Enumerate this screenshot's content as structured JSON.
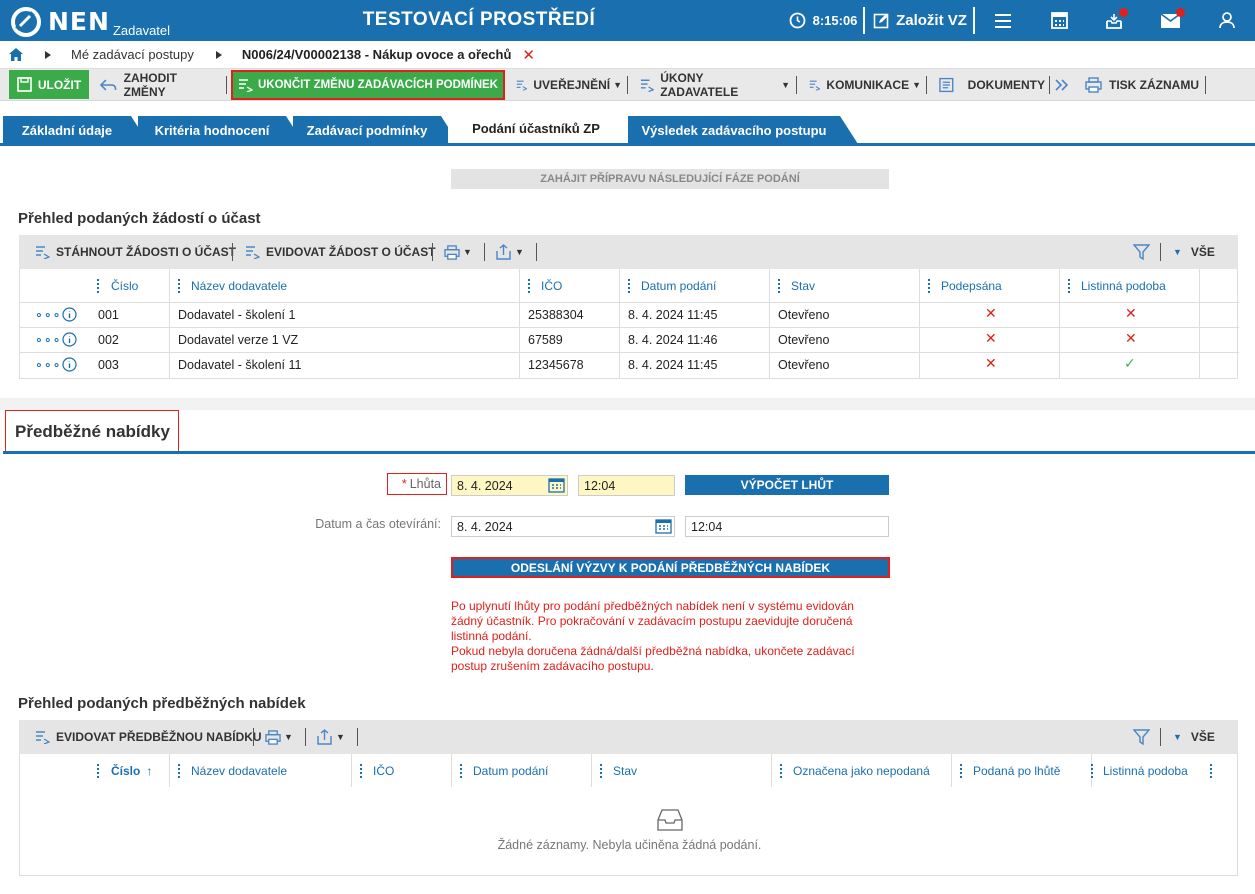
{
  "app": {
    "name": "NEN",
    "subtitle": "Zadavatel",
    "environment": "TESTOVACÍ PROSTŘEDÍ"
  },
  "topbar": {
    "time": "8:15:06",
    "create_label": "Založit VZ",
    "icons": [
      "clock-icon",
      "edit-icon",
      "menu-icon",
      "calculator-icon",
      "inbox-icon",
      "mail-icon",
      "user-icon"
    ],
    "accent": "#1a6fae",
    "badge_color": "#e0201b"
  },
  "breadcrumb": {
    "items": [
      "Mé zadávací postupy",
      "N006/24/V00002138 - Nákup ovoce a ořechů"
    ]
  },
  "toolbar": {
    "save": "ULOŽIT",
    "discard": "ZAHODIT ZMĚNY",
    "finish": "UKONČIT ZMĚNU ZADÁVACÍCH PODMÍNEK",
    "publish": "UVEŘEJNĚNÍ",
    "actions": "ÚKONY ZADAVATELE",
    "communication": "KOMUNIKACE",
    "documents": "DOKUMENTY",
    "print": "TISK ZÁZNAMU"
  },
  "tabs": [
    {
      "label": "Základní údaje"
    },
    {
      "label": "Kritéria hodnocení"
    },
    {
      "label": "Zadávací podmínky"
    },
    {
      "label": "Podání účastníků ZP",
      "active": true
    },
    {
      "label": "Výsledek zadávacího postupu"
    }
  ],
  "phase_button": "ZAHÁJIT PŘÍPRAVU NÁSLEDUJÍCÍ FÁZE PODÁNÍ",
  "requests": {
    "title": "Přehled podaných žádostí o účast",
    "toolbar": {
      "download": "STÁHNOUT ŽÁDOSTI O ÚČAST",
      "register": "EVIDOVAT ŽÁDOST O ÚČAST",
      "all": "VŠE"
    },
    "columns": [
      "Číslo",
      "Název dodavatele",
      "IČO",
      "Datum podání",
      "Stav",
      "Podepsána",
      "Listinná podoba"
    ],
    "rows": [
      {
        "cislo": "001",
        "nazev": "Dodavatel - školení 1",
        "ico": "25388304",
        "datum": "8. 4. 2024 11:45",
        "stav": "Otevřeno",
        "podepsana": "✕",
        "listinna": "✕"
      },
      {
        "cislo": "002",
        "nazev": "Dodavatel verze 1 VZ",
        "ico": "67589",
        "datum": "8. 4. 2024 11:46",
        "stav": "Otevřeno",
        "podepsana": "✕",
        "listinna": "✕"
      },
      {
        "cislo": "003",
        "nazev": "Dodavatel - školení 11",
        "ico": "12345678",
        "datum": "8. 4. 2024 11:45",
        "stav": "Otevřeno",
        "podepsana": "✕",
        "listinna": "✓"
      }
    ]
  },
  "preliminary": {
    "title": "Předběžné nabídky",
    "deadline_label": "Lhůta",
    "required_mark": "*",
    "deadline_date": "8. 4. 2024",
    "deadline_time": "12:04",
    "calc_button": "VÝPOČET LHŮT",
    "open_label": "Datum a čas otevírání:",
    "open_date": "8. 4. 2024",
    "open_time": "12:04",
    "send_button": "ODESLÁNÍ VÝZVY K PODÁNÍ PŘEDBĚŽNÝCH NABÍDEK",
    "warning_lines": [
      "Po uplynutí lhůty pro podání předběžných nabídek není v systému evidován",
      "žádný účastník. Pro pokračování v zadávacím postupu zaevidujte doručená",
      "listinná podání.",
      "Pokud nebyla doručena žádná/další předběžná nabídka, ukončete zadávací",
      "postup zrušením zadávacího postupu."
    ]
  },
  "offers": {
    "title": "Přehled podaných předběžných nabídek",
    "toolbar": {
      "register": "EVIDOVAT PŘEDBĚŽNOU NABÍDKU",
      "all": "VŠE"
    },
    "columns": [
      "Číslo",
      "Název dodavatele",
      "IČO",
      "Datum podání",
      "Stav",
      "Označena jako nepodaná",
      "Podaná po lhůtě",
      "Listinná podoba"
    ],
    "sort_indicator": "↑",
    "empty": "Žádné záznamy. Nebyla učiněna žádná podání."
  }
}
